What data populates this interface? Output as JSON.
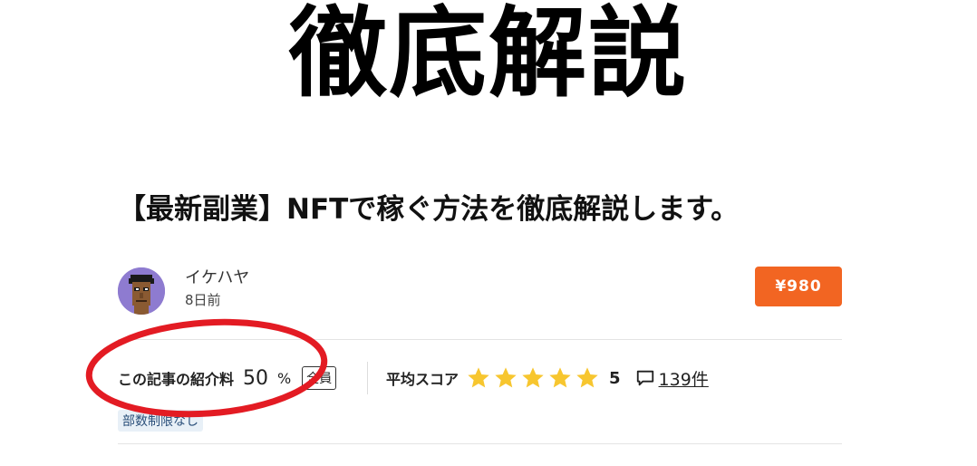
{
  "hero": {
    "title": "徹底解説"
  },
  "article": {
    "title": "【最新副業】NFTで稼ぐ方法を徹底解説します。"
  },
  "author": {
    "name": "イケハヤ",
    "posted": "8日前"
  },
  "purchase": {
    "price_label": "¥980",
    "color": "#f26522"
  },
  "referral": {
    "label": "この記事の紹介料",
    "value": "50",
    "unit": "%",
    "badge": "全員"
  },
  "review": {
    "label": "平均スコア",
    "stars": 5,
    "score": "5",
    "comment_count": "139件",
    "star_color": "#f7c62f"
  },
  "tags": {
    "limit": "部数制限なし"
  },
  "icons": {
    "star": "star-icon",
    "comment": "comment-icon",
    "avatar": "pixel-avatar"
  },
  "annotation": {
    "color": "#e31b23"
  }
}
